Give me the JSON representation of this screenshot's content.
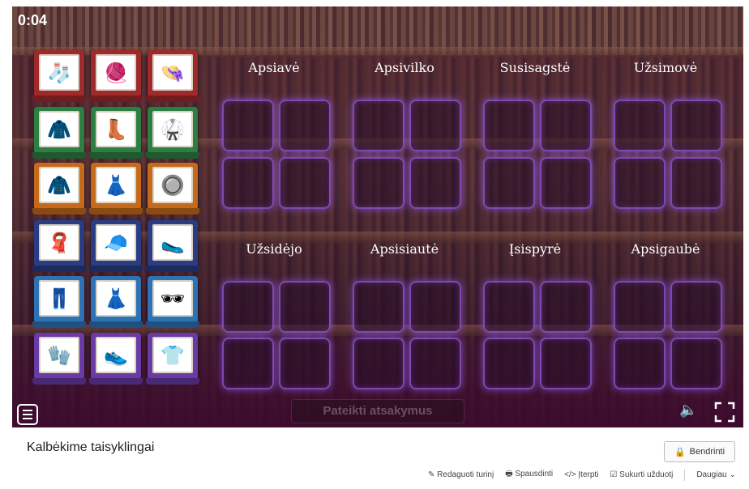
{
  "game": {
    "timer": "0:04",
    "categories": [
      {
        "title": "Apsiavė"
      },
      {
        "title": "Apsivilko"
      },
      {
        "title": "Susisagstė"
      },
      {
        "title": "Užsimovė"
      },
      {
        "title": "Užsidėjo"
      },
      {
        "title": "Apsisiautė"
      },
      {
        "title": "Įsispyrė"
      },
      {
        "title": "Apsigaubė"
      }
    ],
    "cards": [
      {
        "icon": "socks-icon",
        "glyph": "🧦",
        "color": "#9e2a2b"
      },
      {
        "icon": "sweater-icon",
        "glyph": "🧶",
        "color": "#9e2a2b"
      },
      {
        "icon": "sun-hat-icon",
        "glyph": "👒",
        "color": "#9e2a2b"
      },
      {
        "icon": "raincoat-icon",
        "glyph": "🧥",
        "color": "#2e7e43"
      },
      {
        "icon": "rubber-boots-icon",
        "glyph": "👢",
        "color": "#2e7e43"
      },
      {
        "icon": "bathrobe-icon",
        "glyph": "🥋",
        "color": "#2e7e43"
      },
      {
        "icon": "jacket-icon",
        "glyph": "🧥",
        "color": "#c56a1a"
      },
      {
        "icon": "dress-icon",
        "glyph": "👗",
        "color": "#c56a1a"
      },
      {
        "icon": "buttons-icon",
        "glyph": "🔘",
        "color": "#c56a1a"
      },
      {
        "icon": "shawl-icon",
        "glyph": "🧣",
        "color": "#2a3d84"
      },
      {
        "icon": "cap-icon",
        "glyph": "🧢",
        "color": "#2a3d84"
      },
      {
        "icon": "slippers-icon",
        "glyph": "🥿",
        "color": "#2a3d84"
      },
      {
        "icon": "jeans-icon",
        "glyph": "👖",
        "color": "#2d72b5"
      },
      {
        "icon": "skirt-icon",
        "glyph": "👗",
        "color": "#2d72b5"
      },
      {
        "icon": "sunglasses-icon",
        "glyph": "🕶",
        "color": "#2d72b5"
      },
      {
        "icon": "gloves-icon",
        "glyph": "🧤",
        "color": "#6a3aa5"
      },
      {
        "icon": "sneakers-icon",
        "glyph": "👟",
        "color": "#6a3aa5"
      },
      {
        "icon": "tshirt-icon",
        "glyph": "👕",
        "color": "#6a3aa5"
      }
    ],
    "submit_label": "Pateikti atsakymus"
  },
  "footer": {
    "title": "Kalbėkime taisyklingai",
    "share_label": "Bendrinti",
    "links": {
      "edit": "Redaguoti turinį",
      "print": "Spausdinti",
      "embed": "Įterpti",
      "assign": "Sukurti užduotį",
      "more": "Daugiau"
    }
  }
}
